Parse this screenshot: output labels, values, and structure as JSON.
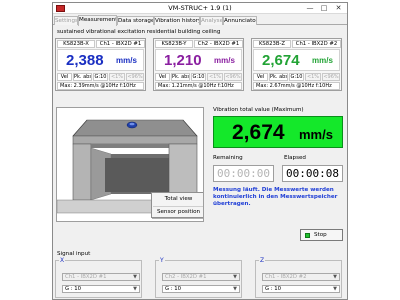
{
  "window": {
    "title": "VM-STRUC+ 1.9 (1)",
    "buttons": {
      "minimize": "—",
      "maximize": "□",
      "close": "✕"
    },
    "icon": "app-icon"
  },
  "tabs": [
    {
      "label": "Settings",
      "state": "disabled"
    },
    {
      "label": "Measurement",
      "state": "active"
    },
    {
      "label": "Data storage",
      "state": "normal"
    },
    {
      "label": "Vibration history",
      "state": "normal"
    },
    {
      "label": "Analyse",
      "state": "disabled"
    },
    {
      "label": "Annunciator",
      "state": "normal"
    }
  ],
  "subtitle": "sustained vibrational excitation residential building ceiling",
  "sensors": [
    {
      "model": "KS823B-X",
      "channel": "Ch1 - IBX2D #1",
      "value": "2,388",
      "unit": "mm/s",
      "color": "#1a2fc2",
      "params": [
        "Vel",
        "Pk. abs",
        "G:10",
        "<1%",
        "<96%"
      ],
      "max": "Max: 2.39mm/s @10Hz    f:10Hz"
    },
    {
      "model": "KS823B-Y",
      "channel": "Ch2 - IBX2D #1",
      "value": "1,210",
      "unit": "mm/s",
      "color": "#8a1fa0",
      "params": [
        "Vel",
        "Pk. abs",
        "G:10",
        "<1%",
        "<96%"
      ],
      "max": "Max: 1.21mm/s @10Hz    f:10Hz"
    },
    {
      "model": "KS823B-Z",
      "channel": "Ch1 - IBX2D #2",
      "value": "2,674",
      "unit": "mm/s",
      "color": "#22a335",
      "params": [
        "Vel",
        "Pk. abs",
        "G:10",
        "<1%",
        "<96%"
      ],
      "max": "Max: 2.67mm/s @10Hz    f:10Hz"
    }
  ],
  "context_menu": {
    "items": [
      "Total view",
      "Sensor position"
    ]
  },
  "total_value": {
    "label": "Vibration total value (Maximum)",
    "value": "2,674",
    "unit": "mm/s",
    "color": "#14e82a"
  },
  "timers": {
    "remaining_label": "Remaining",
    "remaining": "00:00:00",
    "elapsed_label": "Elapsed",
    "elapsed": "00:00:08"
  },
  "status_message": "Messung läuft. Die Messwerte werden kontinuierlich in den Messwertspeicher übertragen.",
  "stop_button": {
    "label": "Stop",
    "led_color": "#21c02f"
  },
  "signal_input": {
    "label": "Signal input",
    "groups": [
      {
        "axis": "X",
        "channel": "Ch1 - IBX2D #1",
        "gain": "G :    10"
      },
      {
        "axis": "Y",
        "channel": "Ch2 - IBX2D #1",
        "gain": "G :    10"
      },
      {
        "axis": "Z",
        "channel": "Ch1 - IBX2D #2",
        "gain": "G :    10"
      }
    ]
  }
}
